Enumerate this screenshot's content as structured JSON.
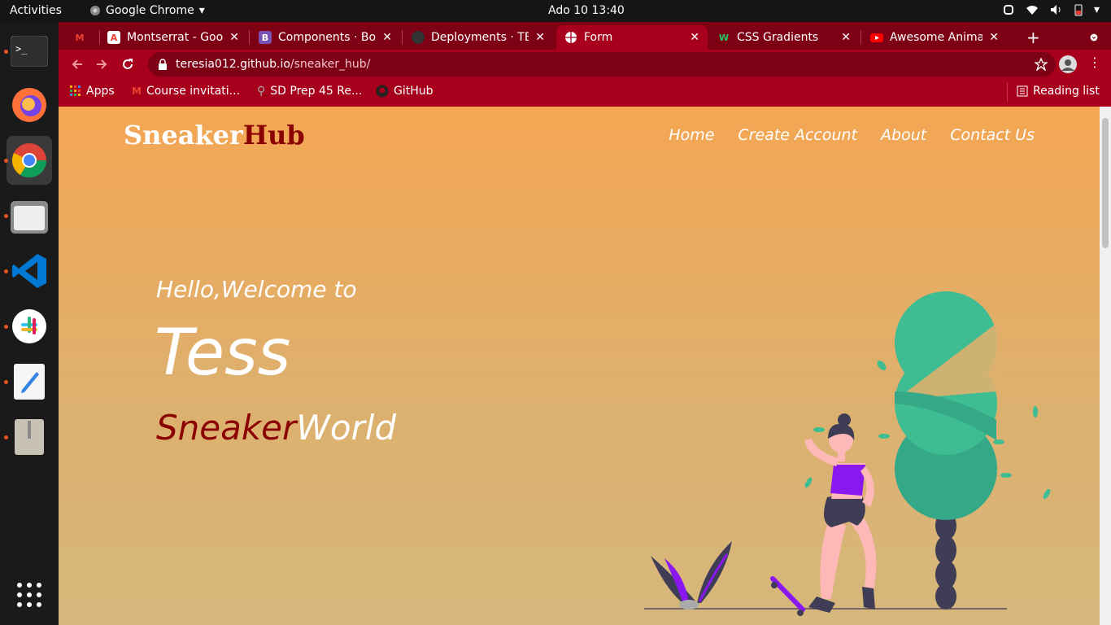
{
  "topbar": {
    "activities": "Activities",
    "app": "Google Chrome",
    "clock": "Ado 10  13:40"
  },
  "tabs": [
    {
      "label": "",
      "icon": "gmail-icon"
    },
    {
      "label": "Montserrat - Goog",
      "icon": "google-fonts-icon"
    },
    {
      "label": "Components · Boo",
      "icon": "bootstrap-icon"
    },
    {
      "label": "Deployments · TE",
      "icon": "github-icon"
    },
    {
      "label": "Form",
      "icon": "globe-icon",
      "active": true
    },
    {
      "label": "CSS Gradients",
      "icon": "w-icon"
    },
    {
      "label": "Awesome Animat",
      "icon": "youtube-icon"
    }
  ],
  "address": {
    "domain": "teresia012.github.io",
    "path": "/sneaker_hub/"
  },
  "bookmarks": [
    {
      "label": "Apps",
      "icon": "apps-grid-icon"
    },
    {
      "label": "Course invitati...",
      "icon": "gmail-icon"
    },
    {
      "label": "SD Prep 45 Re...",
      "icon": "bookmark-icon"
    },
    {
      "label": "GitHub",
      "icon": "github-icon"
    }
  ],
  "reading_list": "Reading list",
  "site": {
    "logo_a": "Sneaker",
    "logo_b": "Hub",
    "nav": [
      "Home",
      "Create Account",
      "About",
      "Contact Us"
    ],
    "hello": "Hello,Welcome to",
    "name": "Tess",
    "sw_a": "Sneaker",
    "sw_b": "World"
  },
  "colors": {
    "brand_dark": "#8b0000",
    "white": "#ffffff",
    "chrome_red": "#a8001c",
    "tree": "#3ebd93",
    "purple": "#8a16f0"
  }
}
